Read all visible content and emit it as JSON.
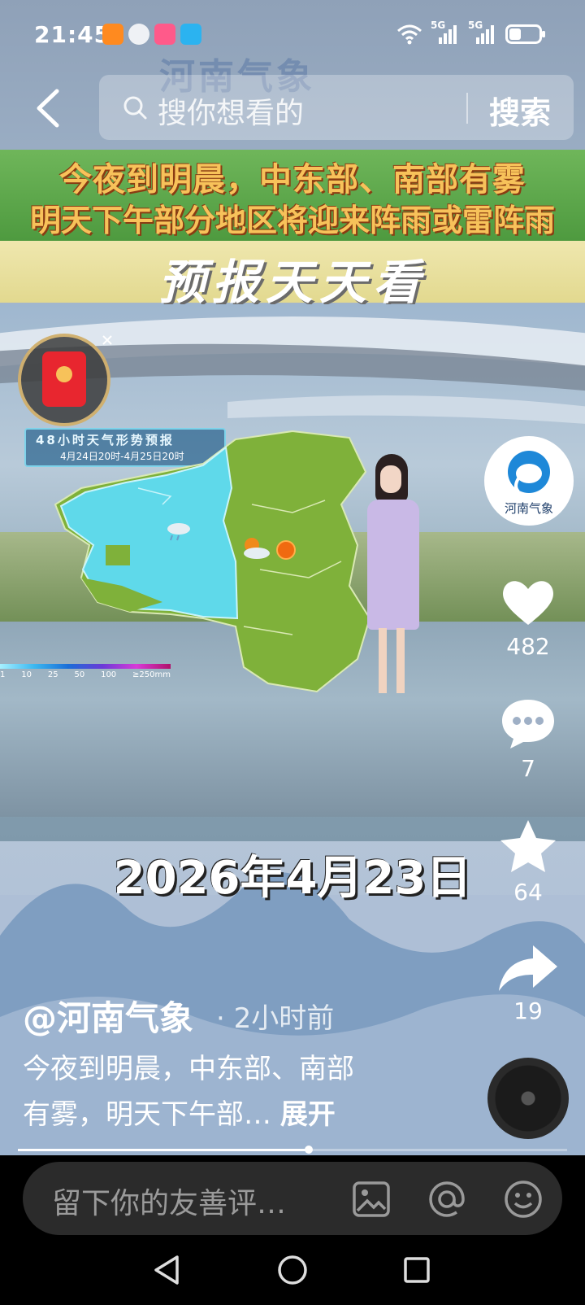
{
  "status_bar": {
    "time": "21:45",
    "signal_1": "5G",
    "signal_2": "5G"
  },
  "header": {
    "watermark": "河南气象",
    "search_placeholder": "搜你想看的",
    "search_button": "搜索"
  },
  "video": {
    "banner_line_1": "今夜到明晨，中东部、南部有雾",
    "banner_line_2": "明天下午部分地区将迎来阵雨或雷阵雨",
    "forecast_title": "预报天天看",
    "map_title": "48小时天气形势预报",
    "map_subtitle": "4月24日20时-4月25日20时",
    "legend_labels": [
      "1",
      "10",
      "25",
      "50",
      "100",
      "≥250mm"
    ],
    "date_overlay": "2026年4月23日",
    "progress_fraction": 0.53
  },
  "actions": {
    "channel_badge_label": "河南气象",
    "likes": "482",
    "comments": "7",
    "favorites": "64",
    "shares": "19"
  },
  "post": {
    "username": "@河南气象",
    "time_ago": "· 2小时前",
    "description_line_1": "今夜到明晨，中东部、南部",
    "description_line_2": "有雾，明天下午部…",
    "expand_label": "展开"
  },
  "comment_bar": {
    "placeholder": "留下你的友善评…"
  },
  "colors": {
    "banner_green": "#5aa845",
    "banner_text": "#f7c25a",
    "map_green": "#7fb13a",
    "map_cyan": "#5fd9ea",
    "red_packet": "#e8262f"
  }
}
